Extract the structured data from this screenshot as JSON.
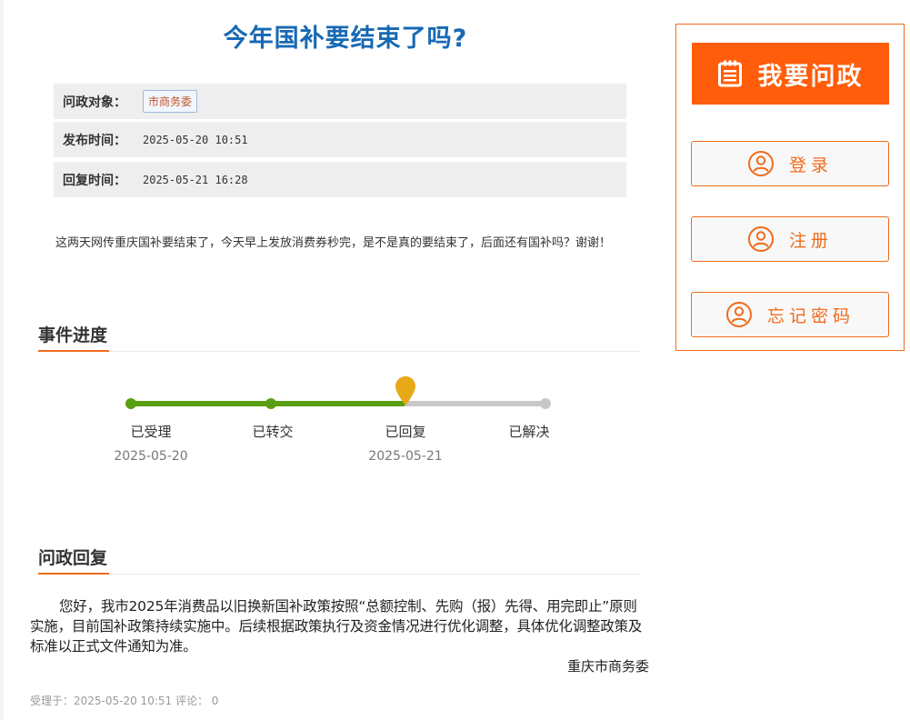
{
  "question": {
    "title": "今年国补要结束了吗?",
    "meta": [
      {
        "label": "问政对象：",
        "value": "市商务委"
      },
      {
        "label": "发布时间：",
        "value": "2025-05-20 10:51"
      },
      {
        "label": "回复时间：",
        "value": "2025-05-21 16:28"
      }
    ],
    "body": "这两天网传重庆国补要结束了，今天早上发放消费券秒完，是不是真的要结束了，后面还有国补吗？谢谢！"
  },
  "progress": {
    "heading": "事件进度",
    "steps": [
      {
        "label": "已受理",
        "date": "2025-05-20"
      },
      {
        "label": "已转交",
        "date": ""
      },
      {
        "label": "已回复",
        "date": "2025-05-21"
      },
      {
        "label": "已解决",
        "date": ""
      }
    ],
    "current_step": 3,
    "colors": {
      "done": "#5a9e12",
      "pending": "#c8c8c8",
      "marker": "#e8a817"
    }
  },
  "reply": {
    "heading": "问政回复",
    "body": "您好，我市2025年消费品以旧换新国补政策按照“总额控制、先购（报）先得、用完即止”原则实施，目前国补政策持续实施中。后续根据政策执行及资金情况进行优化调整，具体优化调整政策及标准以正式文件通知为准。",
    "signer": "重庆市商务委"
  },
  "footer": {
    "text": "受理于：2025-05-20 10:51 评论： 0"
  },
  "sidebar": {
    "ask_button": {
      "label": "我要问政",
      "icon": "notepad-icon"
    },
    "login_button": {
      "label": "登录",
      "icon": "user-icon"
    },
    "register_button": {
      "label": "注册",
      "icon": "user-icon"
    },
    "forgot_button": {
      "label": "忘记密码",
      "icon": "user-icon"
    },
    "accent": "#f06b1c",
    "primary": "#ff5d0b"
  },
  "title_color": "#1769b3"
}
